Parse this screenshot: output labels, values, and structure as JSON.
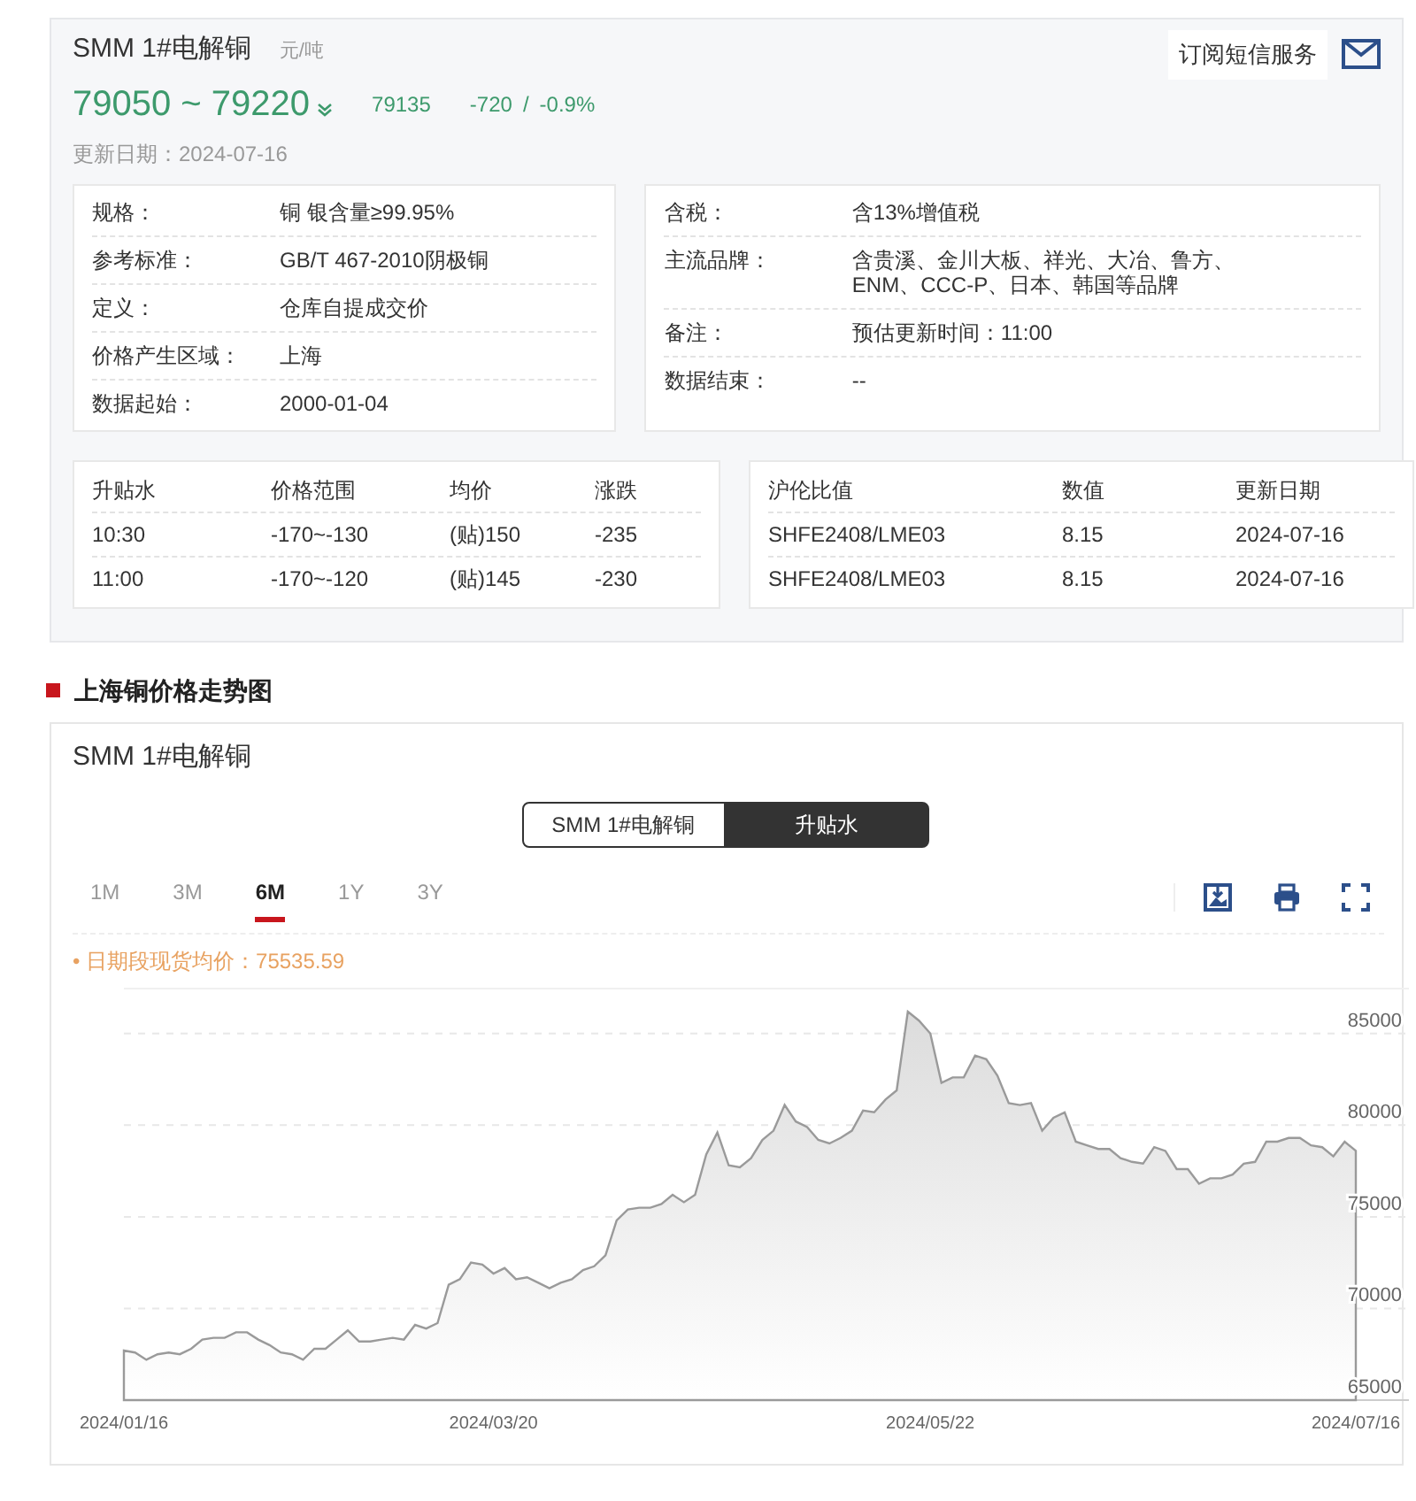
{
  "product": {
    "title": "SMM 1#电解铜",
    "unit": "元/吨",
    "price_range": "79050 ~ 79220",
    "average": "79135",
    "change": "-720",
    "separator": "/",
    "change_pct": "-0.9%",
    "updated": "更新日期：2024-07-16"
  },
  "subscribe_button": "订阅短信服务",
  "spec_left": [
    {
      "label": "规格：",
      "value": "铜 银含量≥99.95%"
    },
    {
      "label": "参考标准：",
      "value": "GB/T 467-2010阴极铜"
    },
    {
      "label": "定义：",
      "value": "仓库自提成交价"
    },
    {
      "label": "价格产生区域：",
      "value": "上海"
    },
    {
      "label": "数据起始：",
      "value": "2000-01-04"
    }
  ],
  "spec_right": [
    {
      "label": "含税：",
      "value": "含13%增值税"
    },
    {
      "label": "主流品牌：",
      "value": "含贵溪、金川大板、祥光、大冶、鲁方、ENM、CCC-P、日本、韩国等品牌"
    },
    {
      "label": "备注：",
      "value": "预估更新时间：11:00"
    },
    {
      "label": "数据结束：",
      "value": "--"
    }
  ],
  "premium_table": {
    "columns": [
      "升贴水",
      "价格范围",
      "均价",
      "涨跌"
    ],
    "rows": [
      [
        "10:30",
        "-170~-130",
        "(贴)150",
        "-235"
      ],
      [
        "11:00",
        "-170~-120",
        "(贴)145",
        "-230"
      ]
    ]
  },
  "ratio_table": {
    "columns": [
      "沪伦比值",
      "数值",
      "更新日期"
    ],
    "rows": [
      [
        "SHFE2408/LME03",
        "8.15",
        "2024-07-16"
      ],
      [
        "SHFE2408/LME03",
        "8.15",
        "2024-07-16"
      ]
    ]
  },
  "section_title": "上海铜价格走势图",
  "chart_panel": {
    "title": "SMM 1#电解铜",
    "toggle": [
      {
        "label": "SMM 1#电解铜",
        "selected": false
      },
      {
        "label": "升贴水",
        "selected": true
      }
    ],
    "ranges": [
      {
        "label": "1M",
        "selected": false
      },
      {
        "label": "3M",
        "selected": false
      },
      {
        "label": "6M",
        "selected": true
      },
      {
        "label": "1Y",
        "selected": false
      },
      {
        "label": "3Y",
        "selected": false
      }
    ],
    "average_note": "• 日期段现货均价：75535.59",
    "chart_data": {
      "type": "area",
      "grid": true,
      "ylim": [
        65000,
        87500
      ],
      "yticks": [
        65000,
        70000,
        75000,
        80000,
        85000
      ],
      "categories": [
        "2024/01/16",
        null,
        null,
        null,
        null,
        null,
        null,
        null,
        null,
        null,
        null,
        null,
        null,
        null,
        null,
        null,
        null,
        null,
        null,
        null,
        null,
        null,
        null,
        null,
        null,
        null,
        null,
        null,
        null,
        null,
        null,
        null,
        null,
        "2024/03/20",
        null,
        null,
        null,
        null,
        null,
        null,
        null,
        null,
        null,
        null,
        null,
        null,
        null,
        null,
        null,
        null,
        null,
        null,
        null,
        null,
        null,
        null,
        null,
        null,
        null,
        null,
        null,
        null,
        null,
        null,
        null,
        null,
        null,
        null,
        null,
        null,
        null,
        null,
        "2024/05/22",
        null,
        null,
        null,
        null,
        null,
        null,
        null,
        null,
        null,
        null,
        null,
        null,
        null,
        null,
        null,
        null,
        null,
        null,
        null,
        null,
        null,
        null,
        null,
        null,
        null,
        null,
        null,
        null,
        null,
        null,
        null,
        null,
        null,
        null,
        null,
        null,
        null,
        "2024/07/16"
      ],
      "series": [
        {
          "color": "#9a9a9a",
          "values": [
            67700,
            67600,
            67200,
            67500,
            67600,
            67500,
            67800,
            68300,
            68400,
            68400,
            68700,
            68700,
            68300,
            68000,
            67600,
            67500,
            67200,
            67800,
            67800,
            68300,
            68800,
            68200,
            68200,
            68300,
            68400,
            68300,
            69100,
            68900,
            69200,
            71300,
            71600,
            72500,
            72400,
            71900,
            72200,
            71600,
            71700,
            71400,
            71100,
            71400,
            71600,
            72100,
            72300,
            72900,
            74800,
            75400,
            75500,
            75500,
            75700,
            76200,
            75800,
            76200,
            78400,
            79600,
            77800,
            77700,
            78200,
            79200,
            79700,
            81100,
            80200,
            79900,
            79200,
            79000,
            79300,
            79700,
            80800,
            80700,
            81400,
            81900,
            86200,
            85700,
            85000,
            82300,
            82600,
            82600,
            83800,
            83600,
            82700,
            81200,
            81100,
            81200,
            79700,
            80400,
            80700,
            79100,
            78900,
            78700,
            78700,
            78200,
            78000,
            77900,
            78800,
            78600,
            77600,
            77600,
            76800,
            77100,
            77100,
            77300,
            77900,
            78000,
            79100,
            79100,
            79300,
            79300,
            78900,
            78800,
            78300,
            79100,
            78600
          ]
        }
      ]
    }
  }
}
